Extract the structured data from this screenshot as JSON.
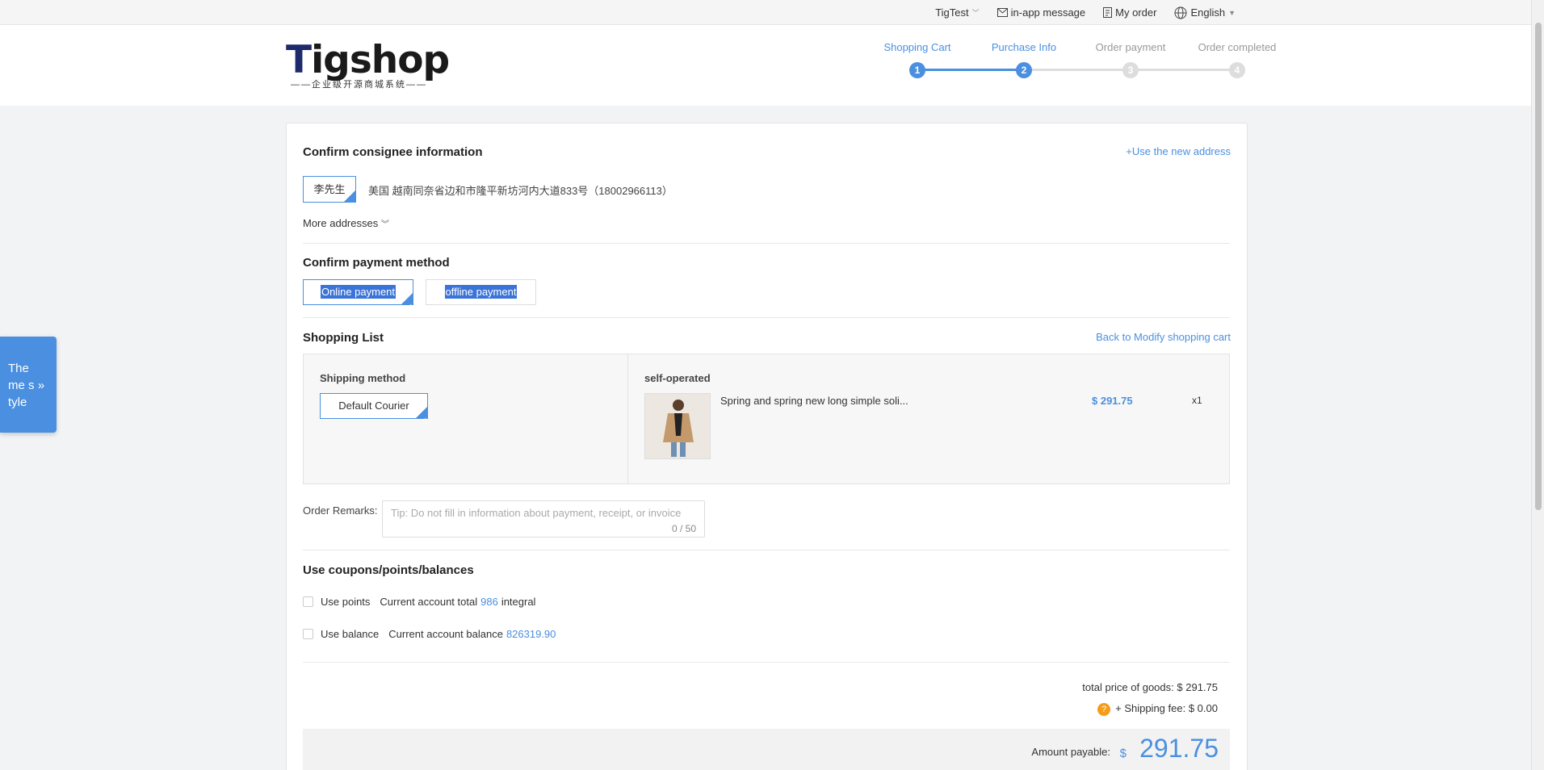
{
  "topbar": {
    "user": "TigTest",
    "message": "in-app message",
    "orders": "My order",
    "language": "English"
  },
  "logo": {
    "text_t": "T",
    "text_rest": "igshop",
    "tagline": "——企业级开源商城系统——"
  },
  "steps": [
    {
      "label": "Shopping Cart",
      "num": "1",
      "active": true
    },
    {
      "label": "Purchase Info",
      "num": "2",
      "active": true
    },
    {
      "label": "Order payment",
      "num": "3",
      "active": false
    },
    {
      "label": "Order completed",
      "num": "4",
      "active": false
    }
  ],
  "consignee": {
    "title": "Confirm consignee information",
    "new_address": "+Use the new address",
    "name": "李先生",
    "address": "美国 越南同奈省边和市隆平新坊河内大道833号（18002966113）",
    "more": "More addresses"
  },
  "payment": {
    "title": "Confirm payment method",
    "online": "Online payment",
    "offline": "offline payment"
  },
  "shopping": {
    "title": "Shopping List",
    "back": "Back to Modify shopping cart",
    "shipping_title": "Shipping method",
    "shipping_option": "Default Courier",
    "shop_name": "self-operated",
    "product_name": "Spring and spring new long simple soli...",
    "product_price": "$ 291.75",
    "product_qty": "x1"
  },
  "remarks": {
    "label": "Order Remarks:",
    "placeholder": "Tip: Do not fill in information about payment, receipt, or invoice",
    "count": "0 / 50"
  },
  "coupons": {
    "title": "Use coupons/points/balances",
    "points_label": "Use points",
    "points_prefix": "Current account total",
    "points_value": "986",
    "points_suffix": "integral",
    "balance_label": "Use balance",
    "balance_prefix": "Current account balance",
    "balance_value": "826319.90"
  },
  "summary": {
    "goods_label": "total price of goods:",
    "goods_value": "$ 291.75",
    "shipping_label": "+ Shipping fee:",
    "shipping_value": "$ 0.00",
    "payable_label": "Amount payable:",
    "payable_currency": "$",
    "payable_value": "291.75"
  },
  "theme_tab": {
    "line1": "The",
    "line2": "me s",
    "line3": "tyle"
  },
  "colors": {
    "accent": "#4a8fe0",
    "warning": "#f59c1a"
  }
}
